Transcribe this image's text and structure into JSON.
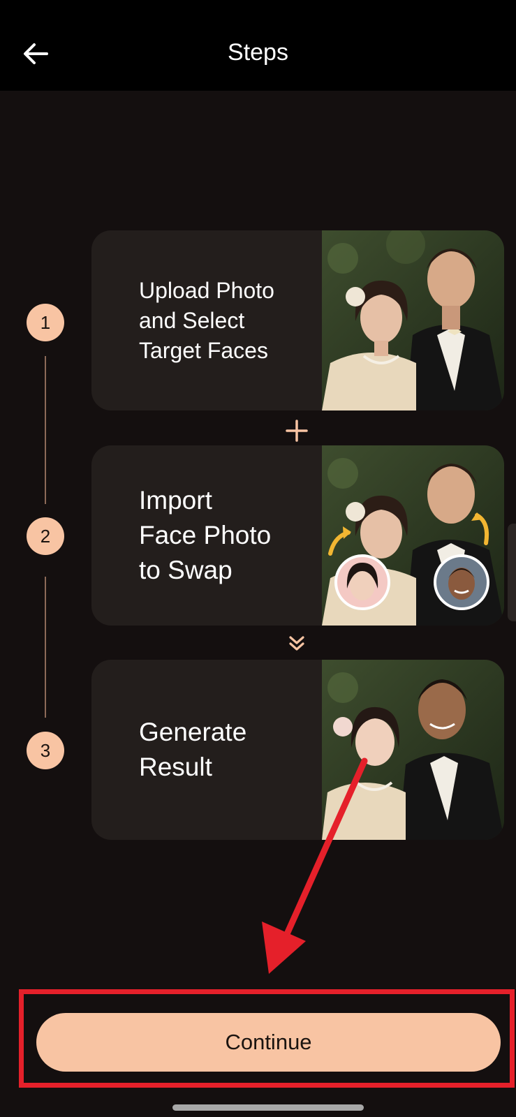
{
  "header": {
    "title": "Steps",
    "back_icon": "arrow-left-icon"
  },
  "steps": [
    {
      "number": "1",
      "label": "Upload Photo\nand Select\nTarget Faces",
      "image": "vintage-couple-photo"
    },
    {
      "number": "2",
      "label": "Import\nFace Photo\nto Swap",
      "image": "vintage-couple-with-face-swap-avatars"
    },
    {
      "number": "3",
      "label": "Generate\nResult",
      "image": "face-swapped-couple-result"
    }
  ],
  "connectors": {
    "between_1_2": "plus-icon",
    "between_2_3": "double-chevron-down-icon"
  },
  "footer": {
    "continue_label": "Continue"
  },
  "colors": {
    "background": "#140f0f",
    "header": "#000000",
    "card": "#231e1c",
    "accent": "#f8c4a3",
    "annotation": "#e5202a"
  }
}
